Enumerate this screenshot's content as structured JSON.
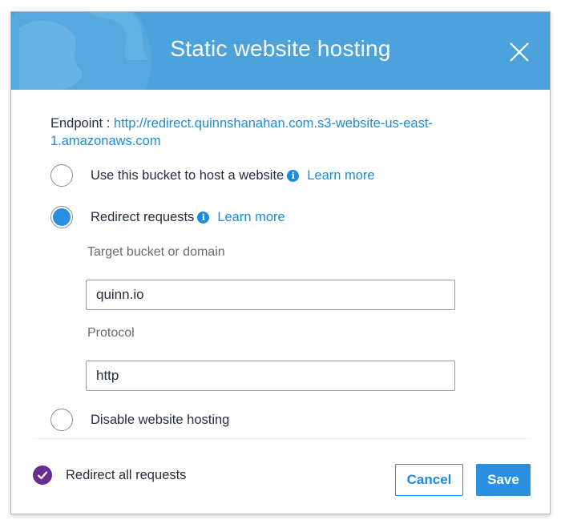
{
  "dialog": {
    "title": "Static website hosting",
    "close_icon": "close-icon"
  },
  "endpoint": {
    "label": "Endpoint : ",
    "url": "http://redirect.quinnshanahan.com.s3-website-us-east-1.amazonaws.com"
  },
  "options": [
    {
      "label": "Use this bucket to host a website",
      "learn_more": "Learn more",
      "selected": false
    },
    {
      "label": "Redirect requests",
      "learn_more": "Learn more",
      "selected": true
    },
    {
      "label": "Disable website hosting",
      "selected": false
    }
  ],
  "redirect": {
    "target_label": "Target bucket or domain",
    "target_value": "quinn.io",
    "protocol_label": "Protocol",
    "protocol_value": "http"
  },
  "footer": {
    "summary_label": "Redirect all requests",
    "cancel_label": "Cancel",
    "save_label": "Save"
  },
  "colors": {
    "header": "#4ca3dc",
    "link": "#1a8cd8",
    "primary": "#2a8fe0",
    "check": "#6b2c8f"
  }
}
